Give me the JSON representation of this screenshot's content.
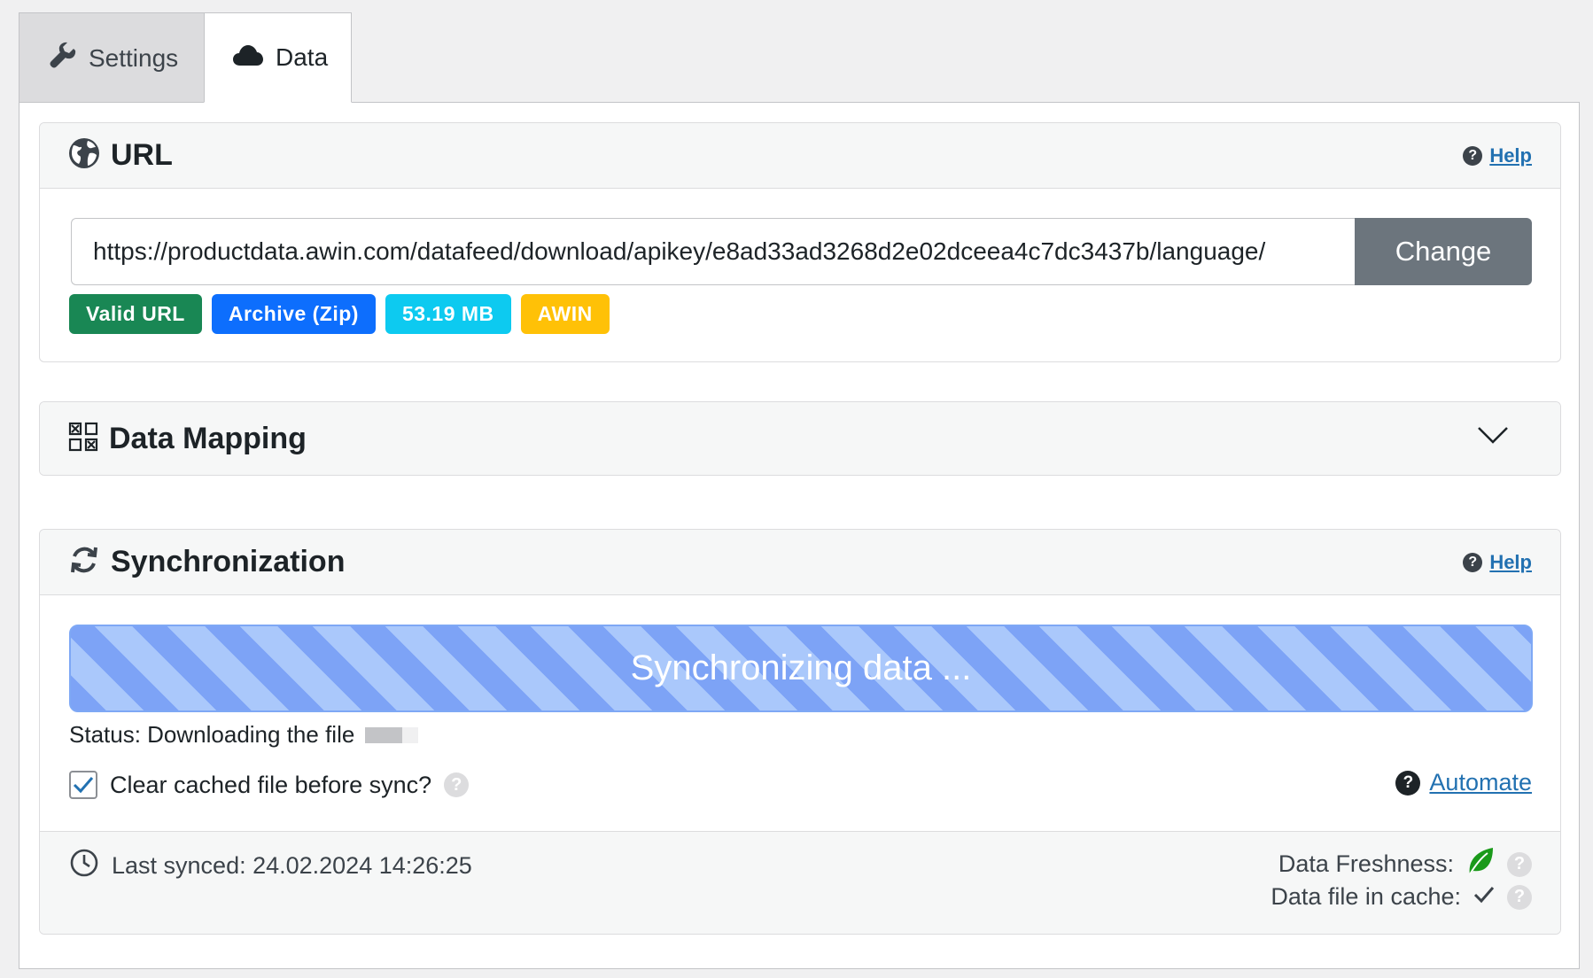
{
  "tabs": [
    {
      "label": "Settings",
      "icon": "wrench-icon",
      "active": false
    },
    {
      "label": "Data",
      "icon": "cloud-icon",
      "active": true
    }
  ],
  "url_section": {
    "title": "URL",
    "icon": "globe-icon",
    "help_label": "Help",
    "url_value": "https://productdata.awin.com/datafeed/download/apikey/e8ad33ad3268d2e02dceea4c7dc3437b/language/",
    "change_label": "Change",
    "badges": [
      {
        "label": "Valid URL",
        "color": "#198754"
      },
      {
        "label": "Archive (Zip)",
        "color": "#0d6efd"
      },
      {
        "label": "53.19 MB",
        "color": "#0dcaf0"
      },
      {
        "label": "AWIN",
        "color": "#ffc107"
      }
    ]
  },
  "mapping_section": {
    "title": "Data Mapping",
    "icon": "qr-grid-icon",
    "toggle_icon": "chevron-down-icon"
  },
  "sync_section": {
    "title": "Synchronization",
    "icon": "sync-icon",
    "help_label": "Help",
    "progress_text": "Synchronizing data ...",
    "progress_fraction": 1.0,
    "status_text": "Status: Downloading the file",
    "status_progress_fraction": 0.7,
    "clear_cache_label": "Clear cached file before sync?",
    "clear_cache_checked": true,
    "automate_label": "Automate",
    "last_synced": "Last synced: 24.02.2024 14:26:25",
    "freshness_label": "Data Freshness:",
    "cache_label": "Data file in cache:"
  },
  "colors": {
    "accent_link": "#2271b1",
    "freshness_leaf": "#1a9a1a",
    "progress_stripe_dark": "#7da3f6",
    "progress_stripe_light": "#aac8fb"
  }
}
